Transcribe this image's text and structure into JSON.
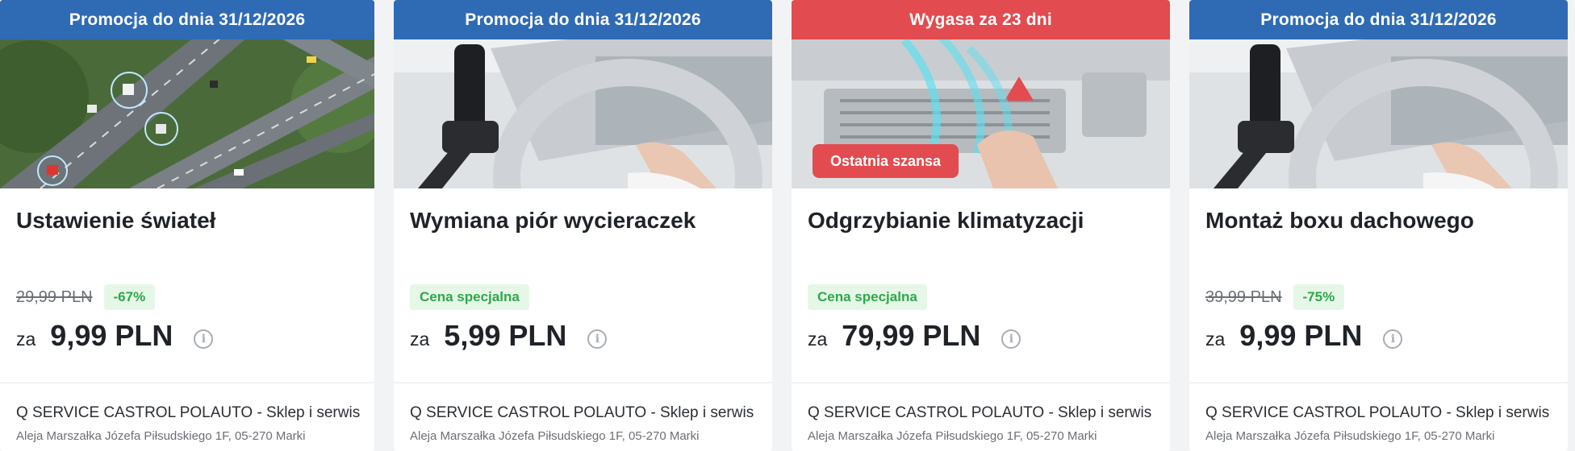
{
  "cards": [
    {
      "banner": "Promocja do dnia 31/12/2026",
      "banner_color": "#2f6bb5",
      "image_subject": "highway-smart-traffic",
      "title": "Ustawienie świateł",
      "old_price": "29,99 PLN",
      "badge": "-67%",
      "price_prefix": "za",
      "price": "9,99 PLN",
      "shop_name": "Q SERVICE CASTROL POLAUTO - Sklep i serwis",
      "shop_address": "Aleja Marszałka Józefa Piłsudskiego 1F, 05-270 Marki"
    },
    {
      "banner": "Promocja do dnia 31/12/2026",
      "banner_color": "#2f6bb5",
      "image_subject": "phone-holder-steering-wheel",
      "title": "Wymiana piór wycieraczek",
      "badge": "Cena specjalna",
      "price_prefix": "za",
      "price": "5,99 PLN",
      "shop_name": "Q SERVICE CASTROL POLAUTO - Sklep i serwis",
      "shop_address": "Aleja Marszałka Józefa Piłsudskiego 1F, 05-270 Marki"
    },
    {
      "banner": "Wygasa za 23 dni",
      "banner_color": "#e24b4f",
      "image_subject": "car-air-vent",
      "last_chance": "Ostatnia szansa",
      "title": "Odgrzybianie klimatyzacji",
      "badge": "Cena specjalna",
      "price_prefix": "za",
      "price": "79,99 PLN",
      "shop_name": "Q SERVICE CASTROL POLAUTO - Sklep i serwis",
      "shop_address": "Aleja Marszałka Józefa Piłsudskiego 1F, 05-270 Marki"
    },
    {
      "banner": "Promocja do dnia 31/12/2026",
      "banner_color": "#2f6bb5",
      "image_subject": "phone-holder-steering-wheel",
      "title": "Montaż boxu dachowego",
      "old_price": "39,99 PLN",
      "badge": "-75%",
      "price_prefix": "za",
      "price": "9,99 PLN",
      "shop_name": "Q SERVICE CASTROL POLAUTO - Sklep i serwis",
      "shop_address": "Aleja Marszałka Józefa Piłsudskiego 1F, 05-270 Marki"
    }
  ],
  "icons": {
    "info": "info-circle-icon"
  },
  "colors": {
    "promo_banner": "#2f6bb5",
    "expiry_banner": "#e24b4f",
    "discount_text": "#2ea84a",
    "discount_bg": "#e6f7e8"
  }
}
